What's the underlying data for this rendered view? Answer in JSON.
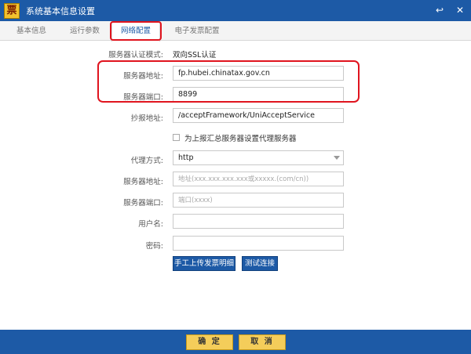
{
  "window": {
    "logo_glyph": "票",
    "title": "系统基本信息设置",
    "back_glyph": "↩",
    "close_glyph": "✕"
  },
  "tabs": [
    {
      "label": "基本信息",
      "active": false
    },
    {
      "label": "运行参数",
      "active": false
    },
    {
      "label": "网络配置",
      "active": true
    },
    {
      "label": "电子发票配置",
      "active": false
    }
  ],
  "form": {
    "auth_mode": {
      "label": "服务器认证模式:",
      "value": "双向SSL认证"
    },
    "server_address": {
      "label": "服务器地址:",
      "value": "fp.hubei.chinatax.gov.cn"
    },
    "server_port": {
      "label": "服务器端口:",
      "value": "8899"
    },
    "report_address": {
      "label": "抄报地址:",
      "value": "/acceptFramework/UniAcceptService"
    },
    "proxy_checkbox": {
      "label": "为上报汇总服务器设置代理服务器",
      "checked": false
    },
    "proxy_type": {
      "label": "代理方式:",
      "value": "http"
    },
    "proxy_address": {
      "label": "服务器地址:",
      "value": "",
      "placeholder": "地址(xxx.xxx.xxx.xxx或xxxxx.(com/cn))"
    },
    "proxy_port": {
      "label": "服务器端口:",
      "value": "",
      "placeholder": "端口(xxxx)"
    },
    "username": {
      "label": "用户名:",
      "value": ""
    },
    "password": {
      "label": "密码:",
      "value": ""
    }
  },
  "buttons": {
    "upload_label": "手工上传发票明细",
    "test_label": "测试连接",
    "ok_label": "确 定",
    "cancel_label": "取 消"
  },
  "colors": {
    "primary": "#1d5aa6",
    "highlight": "#e0141e",
    "footer_button": "#f4cd5a"
  }
}
